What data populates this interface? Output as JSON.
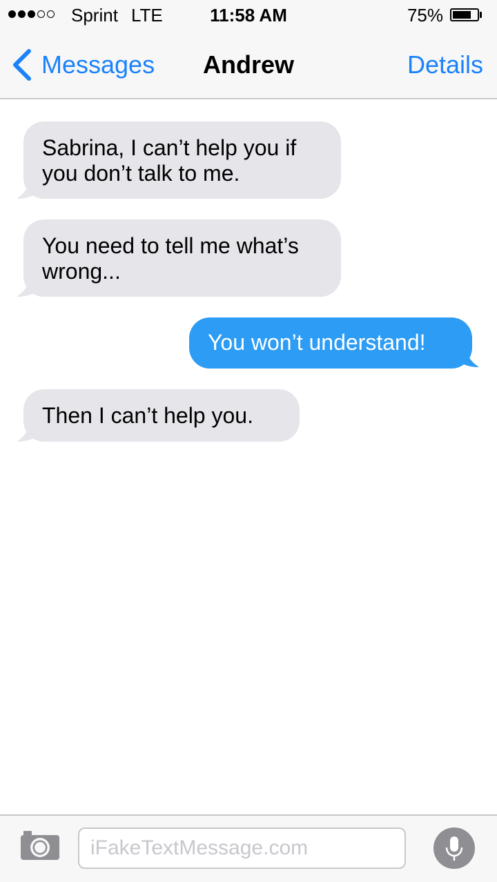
{
  "status_bar": {
    "signal_bars_filled": 3,
    "signal_bars_total": 5,
    "carrier": "Sprint",
    "network": "LTE",
    "time": "11:58 AM",
    "battery_percent": "75%",
    "battery_level": 0.75
  },
  "nav": {
    "back_label": "Messages",
    "title": "Andrew",
    "details_label": "Details"
  },
  "messages": [
    {
      "direction": "received",
      "text": "Sabrina, I can’t help you if you don’t talk to me."
    },
    {
      "direction": "received",
      "text": "You need to tell me what’s wrong..."
    },
    {
      "direction": "sent",
      "text": "You won’t understand!"
    },
    {
      "direction": "received",
      "text": "Then I can’t help you."
    }
  ],
  "input": {
    "placeholder": "iFakeTextMessage.com",
    "value": ""
  },
  "icons": {
    "back": "chevron-left-icon",
    "camera": "camera-icon",
    "mic": "microphone-icon"
  },
  "colors": {
    "accent": "#1a82fb",
    "sent_bubble": "#2c9cf5",
    "received_bubble": "#e5e5ea",
    "bar_background": "#f7f7f7"
  }
}
